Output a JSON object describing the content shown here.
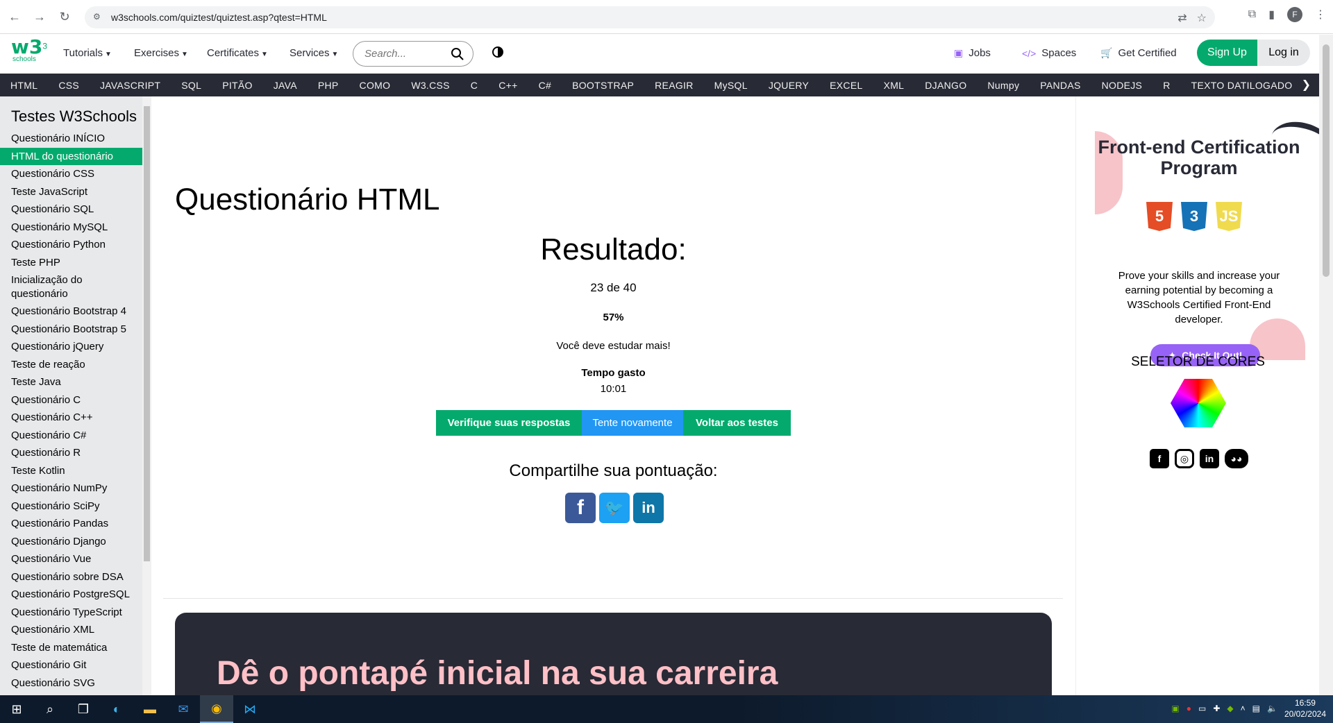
{
  "browser": {
    "url": "w3schools.com/quiztest/quiztest.asp?qtest=HTML",
    "profile_initial": "F"
  },
  "topnav": {
    "logo_text": "w3",
    "logo_sup": "3",
    "logo_sub": "schools",
    "tutorials": "Tutorials",
    "exercises": "Exercises",
    "certificates": "Certificates",
    "services": "Services",
    "search_placeholder": "Search...",
    "jobs": "Jobs",
    "spaces": "Spaces",
    "get_certified": "Get Certified",
    "sign_up": "Sign Up",
    "log_in": "Log in"
  },
  "subjects": [
    "HTML",
    "CSS",
    "JAVASCRIPT",
    "SQL",
    "PITÃO",
    "JAVA",
    "PHP",
    "COMO",
    "W3.CSS",
    "C",
    "C++",
    "C#",
    "BOOTSTRAP",
    "REAGIR",
    "MySQL",
    "JQUERY",
    "EXCEL",
    "XML",
    "DJANGO",
    "Numpy",
    "PANDAS",
    "NODEJS",
    "R",
    "TEXTO DATILOGADO"
  ],
  "sidebar": {
    "title": "Testes W3Schools",
    "items": [
      "Questionário INÍCIO",
      "HTML do questionário",
      "Questionário CSS",
      "Teste JavaScript",
      "Questionário SQL",
      "Questionário MySQL",
      "Questionário Python",
      "Teste PHP",
      "Inicialização do questionário",
      "Questionário Bootstrap 4",
      "Questionário Bootstrap 5",
      "Questionário jQuery",
      "Teste de reação",
      "Teste Java",
      "Questionário C",
      "Questionário C++",
      "Questionário C#",
      "Questionário R",
      "Teste Kotlin",
      "Questionário NumPy",
      "Questionário SciPy",
      "Questionário Pandas",
      "Questionário Django",
      "Questionário Vue",
      "Questionário sobre DSA",
      "Questionário PostgreSQL",
      "Questionário TypeScript",
      "Questionário XML",
      "Teste de matemática",
      "Questionário Git",
      "Questionário SVG"
    ],
    "active_index": 1
  },
  "main": {
    "quiz_title": "Questionário HTML",
    "result_heading": "Resultado:",
    "score": "23 de 40",
    "percent": "57%",
    "advice": "Você deve estudar mais!",
    "time_label": "Tempo gasto",
    "time_value": "10:01",
    "btn_check": "Verifique suas respostas",
    "btn_retry": "Tente novamente",
    "btn_back": "Voltar aos testes",
    "share_heading": "Compartilhe sua pontuação:",
    "banner_heading": "Dê o pontapé inicial na sua carreira"
  },
  "rightbar": {
    "ad_title": "Front-end Certification Program",
    "ad_text": "Prove your skills and increase your earning potential by becoming a W3Schools Certified Front-End developer.",
    "ad_button": "Check It Out!",
    "color_picker_heading": "SELETOR DE CORES"
  },
  "taskbar": {
    "time": "16:59",
    "date": "20/02/2024"
  },
  "colors": {
    "brand_green": "#04AA6D",
    "dark": "#282A35",
    "blue_button": "#2196F3",
    "purple": "#9763f6",
    "banner_pink": "#FFC0C7"
  }
}
